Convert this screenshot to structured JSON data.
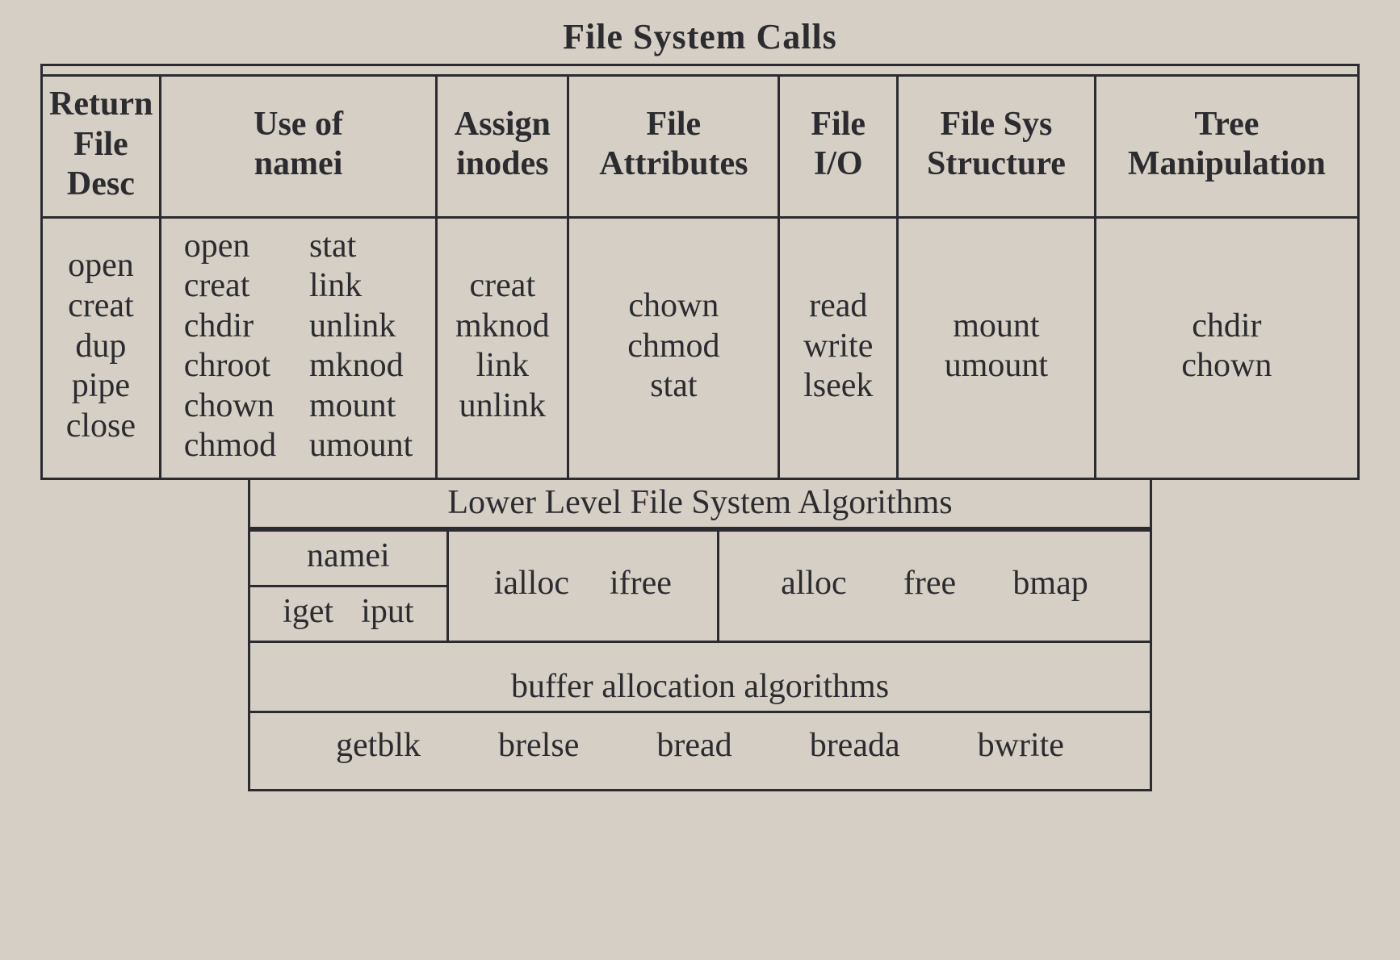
{
  "title": "File System Calls",
  "columns": {
    "c1": "Return\nFile\nDesc",
    "c2": "Use of\nnamei",
    "c3": "Assign\ninodes",
    "c4": "File\nAttributes",
    "c5": "File\nI/O",
    "c6": "File Sys\nStructure",
    "c7": "Tree\nManipulation"
  },
  "cells": {
    "c1": [
      "open",
      "creat",
      "dup",
      "pipe",
      "close"
    ],
    "c2_left": [
      "open",
      "creat",
      "chdir",
      "chroot",
      "chown",
      "chmod"
    ],
    "c2_right": [
      "stat",
      "link",
      "unlink",
      "mknod",
      "mount",
      "umount"
    ],
    "c3": [
      "creat",
      "mknod",
      "link",
      "unlink"
    ],
    "c4": [
      "chown",
      "chmod",
      "stat"
    ],
    "c5": [
      "read",
      "write",
      "lseek"
    ],
    "c6": [
      "mount",
      "umount"
    ],
    "c7": [
      "chdir",
      "chown"
    ]
  },
  "lower": {
    "title": "Lower Level File System Algorithms",
    "group1_head": "namei",
    "group1_body": [
      "iget",
      "iput"
    ],
    "group2_body": [
      "ialloc",
      "ifree"
    ],
    "group3_body": [
      "alloc",
      "free",
      "bmap"
    ]
  },
  "buffer": {
    "title": "buffer allocation algorithms",
    "body": [
      "getblk",
      "brelse",
      "bread",
      "breada",
      "bwrite"
    ]
  },
  "chart_data": {
    "type": "table",
    "title": "File System Calls",
    "top_table": {
      "headers": [
        "Return File Desc",
        "Use of namei",
        "Assign inodes",
        "File Attributes",
        "File I/O",
        "File Sys Structure",
        "Tree Manipulation"
      ],
      "cells": [
        [
          "open",
          "creat",
          "dup",
          "pipe",
          "close"
        ],
        [
          "open",
          "stat",
          "creat",
          "link",
          "chdir",
          "unlink",
          "chroot",
          "mknod",
          "chown",
          "mount",
          "chmod",
          "umount"
        ],
        [
          "creat",
          "mknod",
          "link",
          "unlink"
        ],
        [
          "chown",
          "chmod",
          "stat"
        ],
        [
          "read",
          "write",
          "lseek"
        ],
        [
          "mount",
          "umount"
        ],
        [
          "chdir",
          "chown"
        ]
      ]
    },
    "lower_level": {
      "title": "Lower Level File System Algorithms",
      "groups": [
        {
          "head": "namei",
          "items": [
            "iget",
            "iput"
          ]
        },
        {
          "head": null,
          "items": [
            "ialloc",
            "ifree"
          ]
        },
        {
          "head": null,
          "items": [
            "alloc",
            "free",
            "bmap"
          ]
        }
      ]
    },
    "buffer_layer": {
      "title": "buffer allocation algorithms",
      "items": [
        "getblk",
        "brelse",
        "bread",
        "breada",
        "bwrite"
      ]
    }
  }
}
